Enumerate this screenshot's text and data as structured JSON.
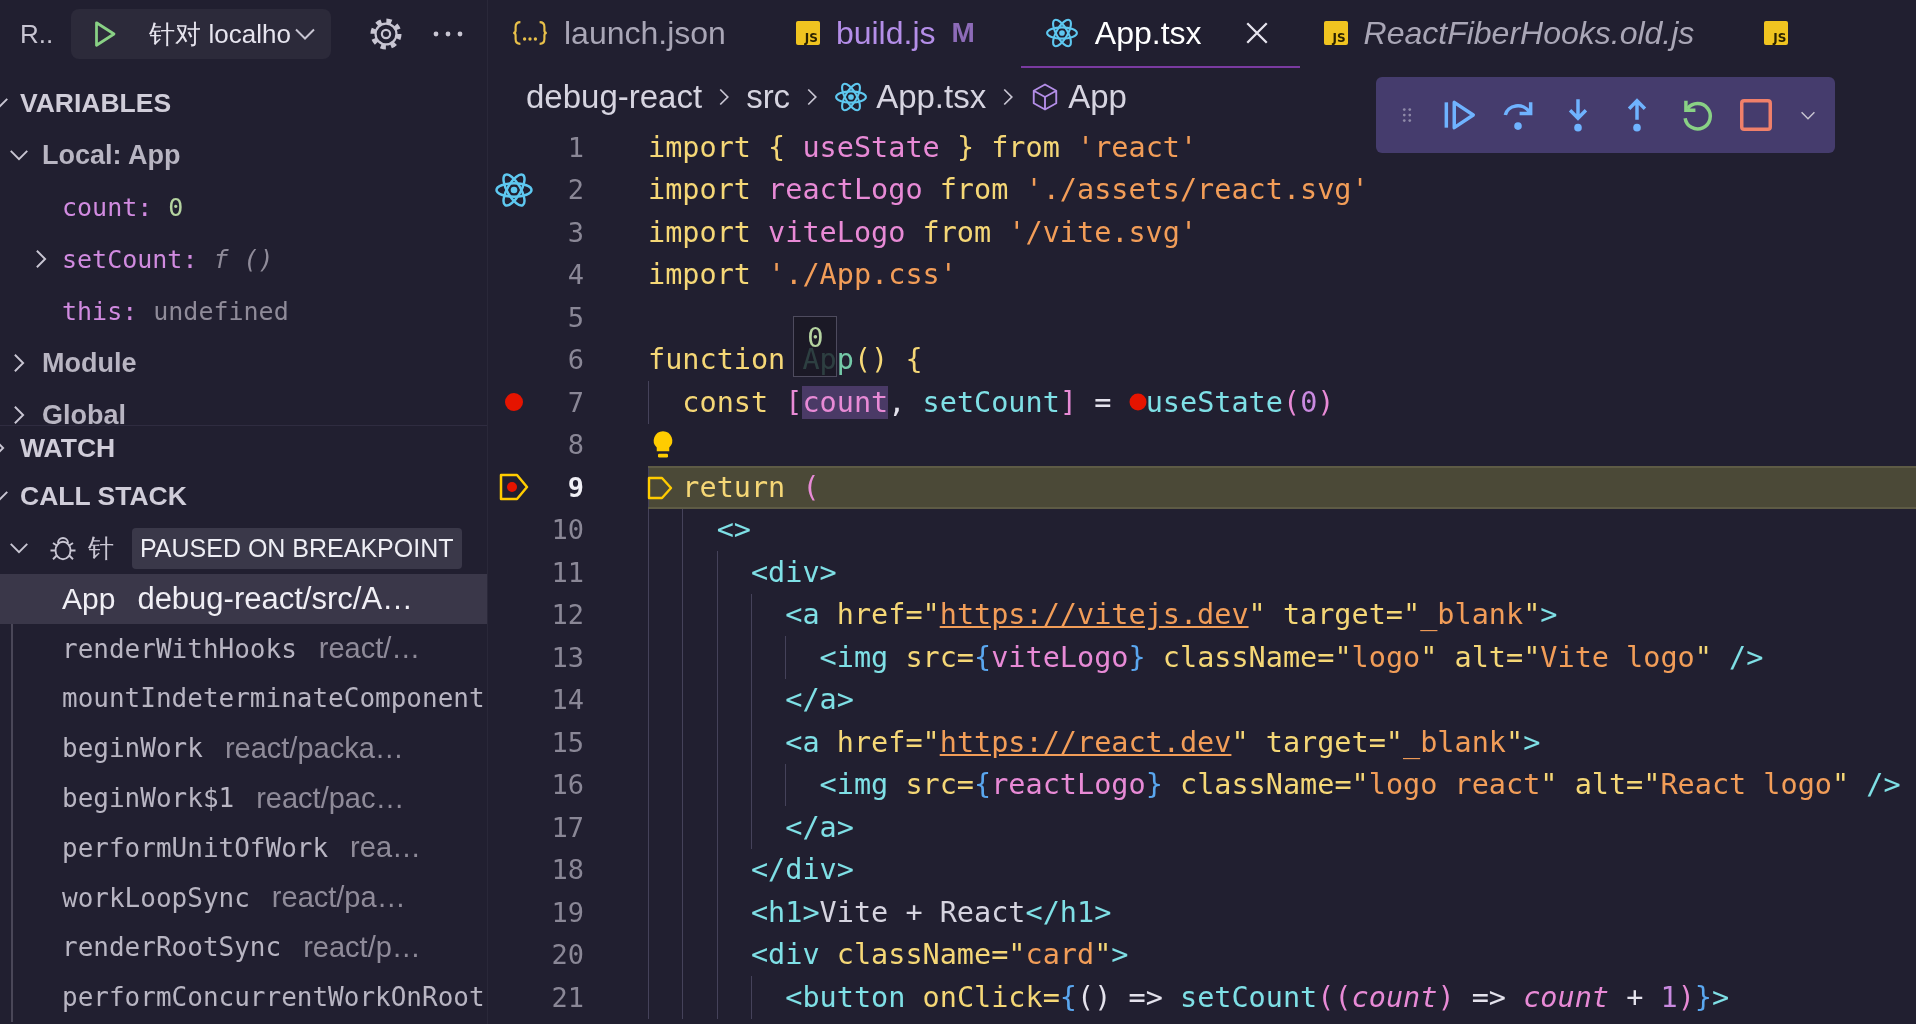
{
  "run_header": {
    "title": "R..",
    "config": "针对 localho"
  },
  "variables": {
    "title": "VARIABLES",
    "expanded": true,
    "scopes": [
      {
        "label": "Local: App",
        "expanded": true,
        "children": [
          {
            "name": "count:",
            "value": "0",
            "kind": "number"
          },
          {
            "name": "setCount:",
            "value": "f ()",
            "kind": "function",
            "expanded": false
          },
          {
            "name": "this:",
            "value": "undefined",
            "kind": "undefined"
          }
        ]
      },
      {
        "label": "Module",
        "expanded": false
      },
      {
        "label": "Global",
        "expanded": false
      }
    ]
  },
  "watch": {
    "title": "WATCH",
    "expanded": false
  },
  "call_stack": {
    "title": "CALL STACK",
    "expanded": true,
    "thread": {
      "name": "针",
      "status": "PAUSED ON BREAKPOINT",
      "expanded": true
    },
    "frames": [
      {
        "name": "App",
        "path": "debug-react/src/A…",
        "selected": true
      },
      {
        "name": "renderWithHooks",
        "path": "react/…",
        "selected": false
      },
      {
        "name": "mountIndeterminateComponent",
        "selected": false
      },
      {
        "name": "beginWork",
        "path": "react/packa…",
        "selected": false
      },
      {
        "name": "beginWork$1",
        "path": "react/pac…",
        "selected": false
      },
      {
        "name": "performUnitOfWork",
        "path": "rea…",
        "selected": false
      },
      {
        "name": "workLoopSync",
        "path": "react/pa…",
        "selected": false
      },
      {
        "name": "renderRootSync",
        "path": "react/p…",
        "selected": false
      },
      {
        "name": "performConcurrentWorkOnRoot",
        "selected": false
      }
    ]
  },
  "tabs": [
    {
      "label": "launch.json",
      "kind": "json",
      "selected": false
    },
    {
      "label": "build.js",
      "kind": "js",
      "icon_label": "JS",
      "git_status": "M",
      "selected": false
    },
    {
      "label": "App.tsx",
      "kind": "react",
      "selected": true
    },
    {
      "label": "ReactFiberHooks.old.js",
      "kind": "js",
      "icon_label": "JS",
      "preview": true,
      "selected": false
    },
    {
      "kind": "js",
      "icon_label": "JS",
      "selected": false
    }
  ],
  "breadcrumb": [
    {
      "label": "debug-react",
      "kind": "folder"
    },
    {
      "label": "src",
      "kind": "folder"
    },
    {
      "label": "App.tsx",
      "kind": "react"
    },
    {
      "label": "App",
      "kind": "symbol"
    }
  ],
  "debug_toolbar": {
    "buttons": [
      {
        "kind": "grip"
      },
      {
        "kind": "continue"
      },
      {
        "kind": "step-over"
      },
      {
        "kind": "step-into"
      },
      {
        "kind": "step-out"
      },
      {
        "kind": "restart"
      },
      {
        "kind": "stop"
      },
      {
        "kind": "dropdown"
      }
    ]
  },
  "code_lines": [
    {
      "number": "1",
      "kind": "code",
      "tokens": [
        {
          "kind": "kw",
          "text": "import { "
        },
        {
          "kind": "id",
          "text": "useState"
        },
        {
          "kind": "kw",
          "text": " } from "
        },
        {
          "kind": "str",
          "text": "'react'"
        }
      ]
    },
    {
      "number": "2",
      "kind": "component",
      "tokens": [
        {
          "kind": "kw",
          "text": "import "
        },
        {
          "kind": "id",
          "text": "reactLogo"
        },
        {
          "kind": "kw",
          "text": " from "
        },
        {
          "kind": "str",
          "text": "'./assets/react.svg'"
        }
      ]
    },
    {
      "number": "3",
      "kind": "code",
      "tokens": [
        {
          "kind": "kw",
          "text": "import "
        },
        {
          "kind": "id",
          "text": "viteLogo"
        },
        {
          "kind": "kw",
          "text": " from "
        },
        {
          "kind": "str",
          "text": "'/vite.svg'"
        }
      ]
    },
    {
      "number": "4",
      "kind": "code",
      "tokens": [
        {
          "kind": "kw",
          "text": "import "
        },
        {
          "kind": "str",
          "text": "'./App.css'"
        }
      ]
    },
    {
      "number": "5",
      "kind": "code"
    },
    {
      "number": "6",
      "kind": "code",
      "tokens": [
        {
          "kind": "kw",
          "text": "function "
        },
        {
          "kind": "name",
          "text": "App",
          "hover_value": "0"
        },
        {
          "kind": "kw",
          "text": "() {"
        }
      ]
    },
    {
      "number": "7",
      "kind": "breakpoint",
      "tokens": [
        {
          "kind": "kw",
          "text": "  const "
        },
        {
          "kind": "id",
          "text": "["
        },
        {
          "kind": "id",
          "text": "count",
          "highlighted": true
        },
        {
          "kind": "plain",
          "text": ", "
        },
        {
          "kind": "fn",
          "text": "setCount"
        },
        {
          "kind": "id",
          "text": "]"
        },
        {
          "kind": "plain",
          "text": " = "
        },
        {
          "kind": "fn",
          "text": "useState",
          "breakpoint_before": true
        },
        {
          "kind": "id",
          "text": "("
        },
        {
          "kind": "num",
          "text": "0"
        },
        {
          "kind": "id",
          "text": ")"
        }
      ]
    },
    {
      "number": "8",
      "kind": "hint"
    },
    {
      "number": "9",
      "kind": "paused",
      "tokens": [
        {
          "kind": "kw",
          "text": "  return "
        },
        {
          "kind": "id",
          "text": "("
        }
      ]
    },
    {
      "number": "10",
      "kind": "code",
      "tokens": [
        {
          "kind": "tag",
          "text": "    <>"
        }
      ]
    },
    {
      "number": "11",
      "kind": "code",
      "tokens": [
        {
          "kind": "tag",
          "text": "      <div>"
        }
      ]
    },
    {
      "number": "12",
      "kind": "code",
      "tokens": [
        {
          "kind": "tag",
          "text": "        <a "
        },
        {
          "kind": "attr",
          "text": "href=\""
        },
        {
          "kind": "url",
          "text": "https://vitejs.dev"
        },
        {
          "kind": "attr",
          "text": "\" target=\""
        },
        {
          "kind": "str",
          "text": "_blank"
        },
        {
          "kind": "attr",
          "text": "\""
        },
        {
          "kind": "tag",
          "text": ">"
        }
      ]
    },
    {
      "number": "13",
      "kind": "code",
      "tokens": [
        {
          "kind": "tag",
          "text": "          <img "
        },
        {
          "kind": "attr",
          "text": "src="
        },
        {
          "kind": "brace",
          "text": "{"
        },
        {
          "kind": "id",
          "text": "viteLogo"
        },
        {
          "kind": "brace",
          "text": "}"
        },
        {
          "kind": "attr",
          "text": " className=\""
        },
        {
          "kind": "str",
          "text": "logo"
        },
        {
          "kind": "attr",
          "text": "\" alt=\""
        },
        {
          "kind": "str",
          "text": "Vite logo"
        },
        {
          "kind": "attr",
          "text": "\" "
        },
        {
          "kind": "tag",
          "text": "/>"
        }
      ]
    },
    {
      "number": "14",
      "kind": "code",
      "tokens": [
        {
          "kind": "tag",
          "text": "        </a>"
        }
      ]
    },
    {
      "number": "15",
      "kind": "code",
      "tokens": [
        {
          "kind": "tag",
          "text": "        <a "
        },
        {
          "kind": "attr",
          "text": "href=\""
        },
        {
          "kind": "url",
          "text": "https://react.dev"
        },
        {
          "kind": "attr",
          "text": "\" target=\""
        },
        {
          "kind": "str",
          "text": "_blank"
        },
        {
          "kind": "attr",
          "text": "\""
        },
        {
          "kind": "tag",
          "text": ">"
        }
      ]
    },
    {
      "number": "16",
      "kind": "code",
      "tokens": [
        {
          "kind": "tag",
          "text": "          <img "
        },
        {
          "kind": "attr",
          "text": "src="
        },
        {
          "kind": "brace",
          "text": "{"
        },
        {
          "kind": "id",
          "text": "reactLogo"
        },
        {
          "kind": "brace",
          "text": "}"
        },
        {
          "kind": "attr",
          "text": " className=\""
        },
        {
          "kind": "str",
          "text": "logo react"
        },
        {
          "kind": "attr",
          "text": "\" alt=\""
        },
        {
          "kind": "str",
          "text": "React logo"
        },
        {
          "kind": "attr",
          "text": "\" "
        },
        {
          "kind": "tag",
          "text": "/>"
        }
      ]
    },
    {
      "number": "17",
      "kind": "code",
      "tokens": [
        {
          "kind": "tag",
          "text": "        </a>"
        }
      ]
    },
    {
      "number": "18",
      "kind": "code",
      "tokens": [
        {
          "kind": "tag",
          "text": "      </div>"
        }
      ]
    },
    {
      "number": "19",
      "kind": "code",
      "tokens": [
        {
          "kind": "tag",
          "text": "      <h1>"
        },
        {
          "kind": "text",
          "text": "Vite + React"
        },
        {
          "kind": "tag",
          "text": "</h1>"
        }
      ]
    },
    {
      "number": "20",
      "kind": "code",
      "tokens": [
        {
          "kind": "tag",
          "text": "      <div "
        },
        {
          "kind": "attr",
          "text": "className=\""
        },
        {
          "kind": "str",
          "text": "card"
        },
        {
          "kind": "attr",
          "text": "\""
        },
        {
          "kind": "tag",
          "text": ">"
        }
      ]
    },
    {
      "number": "21",
      "kind": "code",
      "tokens": [
        {
          "kind": "tag",
          "text": "        <button "
        },
        {
          "kind": "attr",
          "text": "onClick="
        },
        {
          "kind": "brace",
          "text": "{"
        },
        {
          "kind": "plain",
          "text": "() => "
        },
        {
          "kind": "fn",
          "text": "setCount"
        },
        {
          "kind": "id",
          "text": "(("
        },
        {
          "kind": "param",
          "text": "count"
        },
        {
          "kind": "id",
          "text": ")"
        },
        {
          "kind": "plain",
          "text": " => "
        },
        {
          "kind": "param",
          "text": "count"
        },
        {
          "kind": "plain",
          "text": " + "
        },
        {
          "kind": "num",
          "text": "1"
        },
        {
          "kind": "id",
          "text": ")"
        },
        {
          "kind": "brace",
          "text": "}"
        },
        {
          "kind": "tag",
          "text": ">"
        }
      ]
    }
  ]
}
